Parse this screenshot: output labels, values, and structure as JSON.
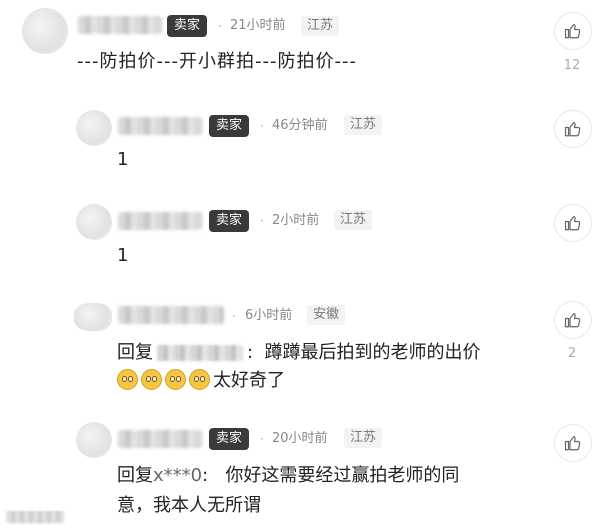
{
  "comments": [
    {
      "seller_badge": "卖家",
      "time": "21小时前",
      "location": "江苏",
      "text": "---防拍价---开小群拍---防拍价---",
      "likes": "12"
    },
    {
      "seller_badge": "卖家",
      "time": "46分钟前",
      "location": "江苏",
      "text": "1",
      "likes": ""
    },
    {
      "seller_badge": "卖家",
      "time": "2小时前",
      "location": "江苏",
      "text": "1",
      "likes": ""
    },
    {
      "time": "6小时前",
      "location": "安徽",
      "reply_prefix": "回复",
      "reply_sep": ":",
      "text": "蹲蹲最后拍到的老师的出价",
      "text_line2": "太好奇了",
      "emoji_count": 4,
      "likes": "2"
    },
    {
      "seller_badge": "卖家",
      "time": "20小时前",
      "location": "江苏",
      "reply_prefix": "回复",
      "reply_target": "x***0",
      "reply_sep": ":",
      "text": "你好这需要经过赢拍老师的同",
      "text_line2": "意，我本人无所谓",
      "likes": ""
    }
  ],
  "icons": {
    "like": "thumbs-up-icon",
    "emoji": "pleading-face-emoji"
  },
  "dot": "·"
}
